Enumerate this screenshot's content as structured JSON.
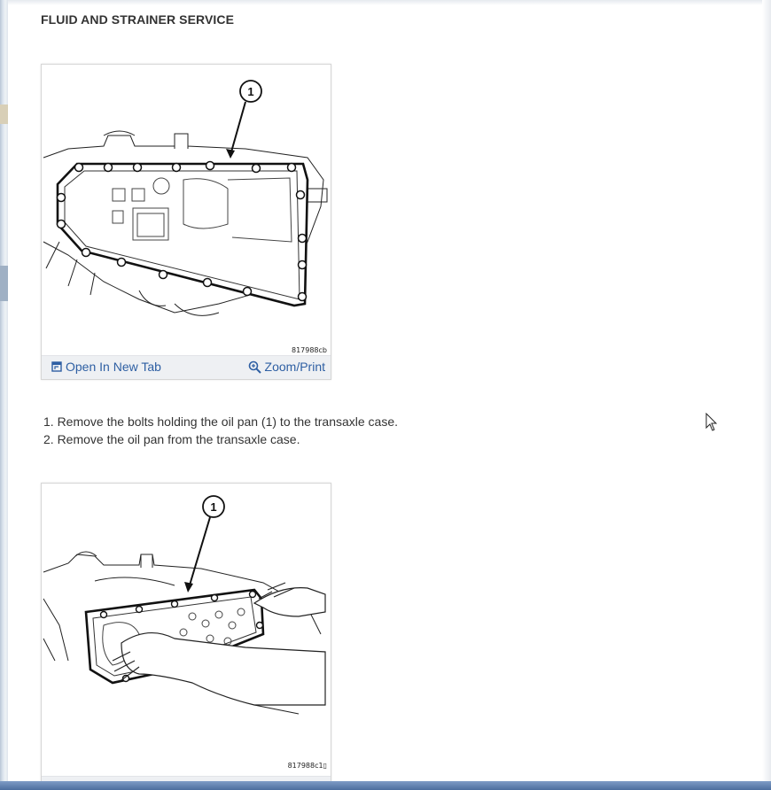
{
  "section": {
    "title": "FLUID AND STRAINER SERVICE"
  },
  "figures": [
    {
      "callout": "1",
      "code": "817988cb",
      "open_label": "Open In New Tab",
      "zoom_label": "Zoom/Print",
      "open_icon": "open-tab-icon",
      "zoom_icon": "magnifier-icon"
    },
    {
      "callout": "1",
      "code": "817988c1▯"
    }
  ],
  "steps": [
    "1. Remove the bolts holding the oil pan (1) to the transaxle case.",
    "2. Remove the oil pan from the transaxle case."
  ],
  "colors": {
    "link": "#2e5fa3",
    "bottom_bar": "#4d6e9e",
    "caption_bar": "#eef0f3"
  }
}
